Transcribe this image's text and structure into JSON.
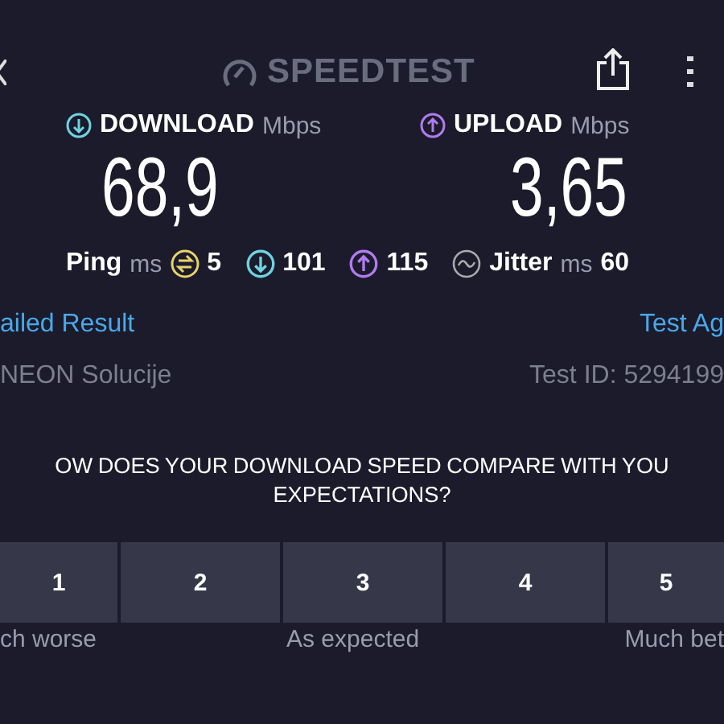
{
  "header": {
    "title": "SPEEDTEST"
  },
  "results": [
    {
      "kind": "download",
      "label": "DOWNLOAD",
      "unit": "Mbps",
      "value": "68,9"
    },
    {
      "kind": "upload",
      "label": "UPLOAD",
      "unit": "Mbps",
      "value": "3,65"
    }
  ],
  "ping": {
    "label": "Ping",
    "unit": "ms",
    "value": "5",
    "download_value": "101",
    "upload_value": "115"
  },
  "jitter": {
    "label": "Jitter",
    "unit": "ms",
    "value": "60"
  },
  "links": {
    "left": "ailed Result",
    "right": "Test Ag"
  },
  "info": {
    "provider": "NEON Solucije",
    "test_id": "Test ID: 5294199"
  },
  "question": "OW DOES YOUR DOWNLOAD SPEED COMPARE WITH YOU EXPECTATIONS?",
  "rating": {
    "options": [
      {
        "label": "1"
      },
      {
        "label": "2"
      },
      {
        "label": "3"
      },
      {
        "label": "4"
      },
      {
        "label": "5"
      }
    ],
    "scale_labels": [
      "ch worse",
      "As expected",
      "Much bet"
    ]
  }
}
